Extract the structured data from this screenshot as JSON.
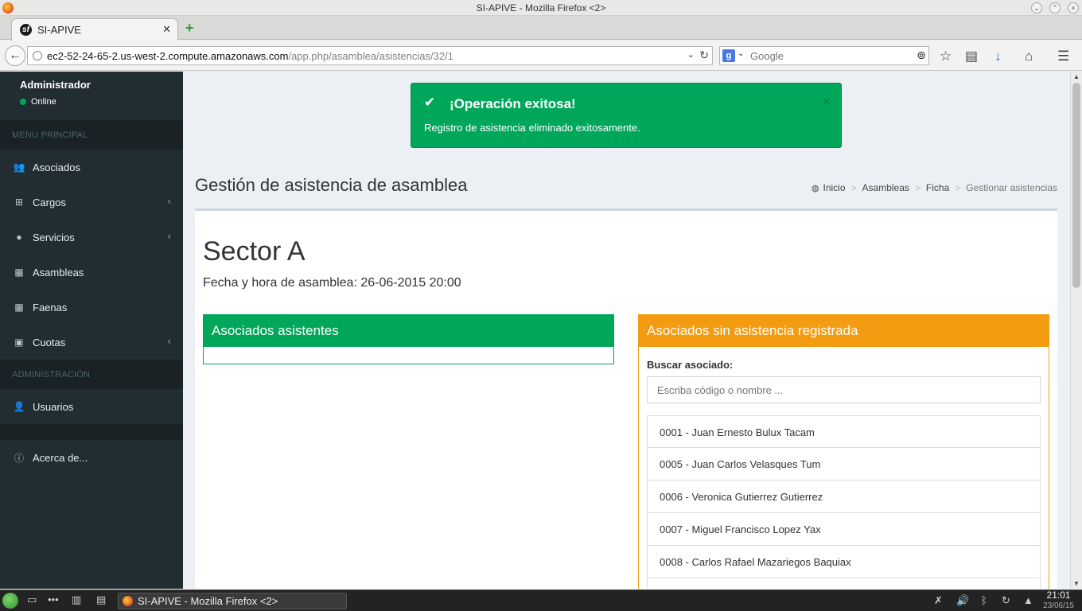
{
  "window": {
    "title": "SI-APIVE - Mozilla Firefox <2>"
  },
  "browser": {
    "tab_title": "SI-APIVE",
    "url_host": "ec2-52-24-65-2.us-west-2.compute.amazonaws.com",
    "url_path": "/app.php/asamblea/asistencias/32/1",
    "search_engine": "Google",
    "search_placeholder": "Google"
  },
  "sidebar": {
    "user_name": "Administrador",
    "user_status": "Online",
    "sections": [
      {
        "header": "MENU PRINCIPAL",
        "items": [
          {
            "label": "Asociados",
            "icon": "users-icon",
            "has_submenu": false
          },
          {
            "label": "Cargos",
            "icon": "sitemap-icon",
            "has_submenu": true
          },
          {
            "label": "Servicios",
            "icon": "tint-icon",
            "has_submenu": true
          },
          {
            "label": "Asambleas",
            "icon": "calendar-icon",
            "has_submenu": false
          },
          {
            "label": "Faenas",
            "icon": "calendar-icon",
            "has_submenu": false
          },
          {
            "label": "Cuotas",
            "icon": "money-icon",
            "has_submenu": true
          }
        ]
      },
      {
        "header": "ADMINISTRACIÓN",
        "items": [
          {
            "label": "Usuarios",
            "icon": "user-icon",
            "has_submenu": false
          }
        ]
      }
    ],
    "about_label": "Acerca de..."
  },
  "alert": {
    "title": "¡Operación exitosa!",
    "message": "Registro de asistencia eliminado exitosamente.",
    "close": "×"
  },
  "page": {
    "title": "Gestión de asistencia de asamblea",
    "breadcrumb": [
      "Inicio",
      "Asambleas",
      "Ficha",
      "Gestionar asistencias"
    ],
    "sector": "Sector A",
    "fecha": "Fecha y hora de asamblea: 26-06-2015 20:00"
  },
  "panels": {
    "attending_title": "Asociados asistentes",
    "not_registered_title": "Asociados sin asistencia registrada",
    "search_label": "Buscar asociado:",
    "search_placeholder": "Escriba código o nombre ...",
    "members": [
      "0001 - Juan Ernesto Bulux Tacam",
      "0005 - Juan Carlos Velasques Tum",
      "0006 - Veronica Gutierrez Gutierrez",
      "0007 - Miguel Francisco Lopez Yax",
      "0008 - Carlos Rafael Mazariegos Baquiax"
    ]
  },
  "taskbar": {
    "task_label": "SI-APIVE - Mozilla Firefox <2>",
    "time": "21:01",
    "date": "23/06/15"
  },
  "colors": {
    "sidebar_bg": "#222d32",
    "success": "#00a65a",
    "warning": "#f39c12",
    "content_bg": "#ecf0f5"
  }
}
